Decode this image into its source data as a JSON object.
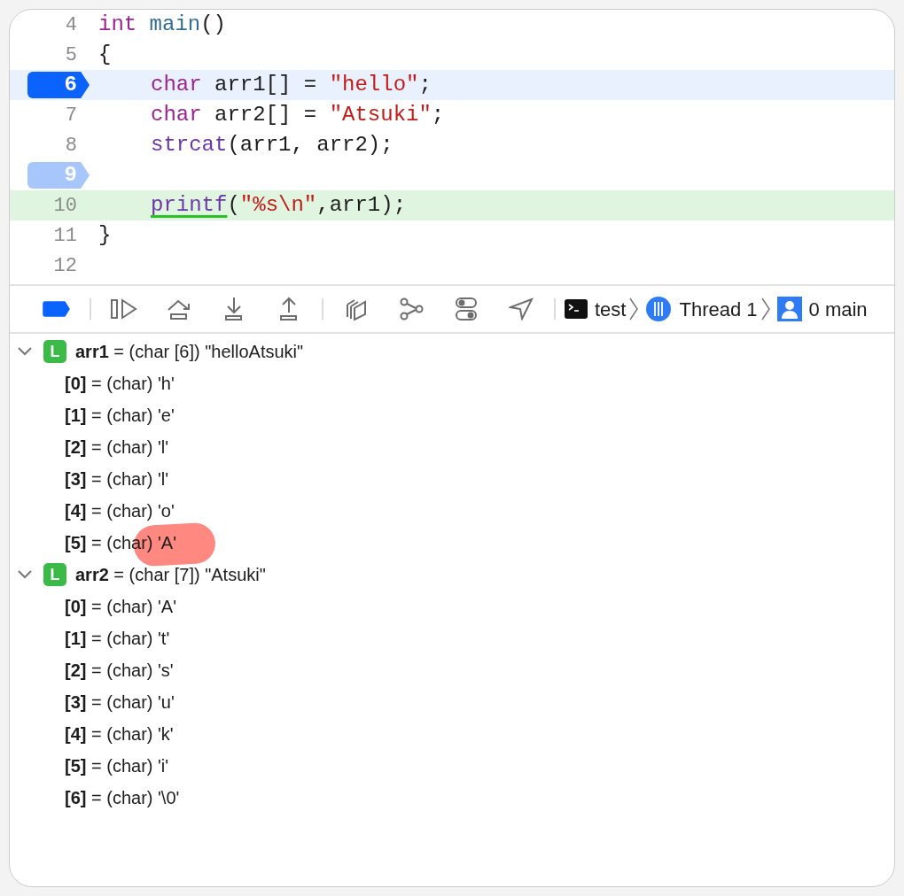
{
  "code_lines": [
    {
      "number": "4",
      "indented": false,
      "breakpoint": false,
      "current": false,
      "executed": false,
      "tokens": [
        {
          "kind": "keyword",
          "text": "int "
        },
        {
          "kind": "decl",
          "text": "main"
        },
        {
          "kind": "plain",
          "text": "()"
        }
      ]
    },
    {
      "number": "5",
      "indented": false,
      "breakpoint": false,
      "current": false,
      "executed": false,
      "tokens": [
        {
          "kind": "plain",
          "text": "{"
        }
      ]
    },
    {
      "number": "6",
      "indented": true,
      "breakpoint": true,
      "breakpoint_active": true,
      "current": true,
      "executed": false,
      "tokens": [
        {
          "kind": "keyword",
          "text": "char"
        },
        {
          "kind": "plain",
          "text": " arr1[] = "
        },
        {
          "kind": "string",
          "text": "\"hello\""
        },
        {
          "kind": "plain",
          "text": ";"
        }
      ]
    },
    {
      "number": "7",
      "indented": true,
      "breakpoint": false,
      "current": false,
      "executed": false,
      "tokens": [
        {
          "kind": "keyword",
          "text": "char"
        },
        {
          "kind": "plain",
          "text": " arr2[] = "
        },
        {
          "kind": "string",
          "text": "\"Atsuki\""
        },
        {
          "kind": "plain",
          "text": ";"
        }
      ]
    },
    {
      "number": "8",
      "indented": true,
      "breakpoint": false,
      "current": false,
      "executed": false,
      "tokens": [
        {
          "kind": "call",
          "text": "strcat"
        },
        {
          "kind": "plain",
          "text": "(arr1, arr2);"
        }
      ]
    },
    {
      "number": "9",
      "breakpoint": true,
      "breakpoint_active": false,
      "current": false,
      "executed": false
    },
    {
      "number": "10",
      "indented": true,
      "breakpoint": false,
      "current": false,
      "executed": true,
      "tokens": [
        {
          "kind": "call",
          "text": "printf",
          "underlined": true
        },
        {
          "kind": "plain",
          "text": "("
        },
        {
          "kind": "string",
          "text": "\"%s\\n\""
        },
        {
          "kind": "plain",
          "text": ",arr1);"
        }
      ]
    },
    {
      "number": "11",
      "indented": false,
      "breakpoint": false,
      "current": false,
      "executed": false,
      "tokens": [
        {
          "kind": "plain",
          "text": "}"
        }
      ]
    },
    {
      "number": "12",
      "breakpoint": false,
      "current": false,
      "executed": false
    }
  ],
  "debug_bar": {
    "tools": [
      {
        "kind": "breakpoints",
        "on": true
      },
      {
        "kind": "separator"
      },
      {
        "kind": "continue"
      },
      {
        "kind": "step-over"
      },
      {
        "kind": "step-into"
      },
      {
        "kind": "step-out"
      },
      {
        "kind": "separator"
      },
      {
        "kind": "view-hierarchy"
      },
      {
        "kind": "memory-graph"
      },
      {
        "kind": "environment"
      },
      {
        "kind": "location"
      },
      {
        "kind": "separator"
      }
    ],
    "breadcrumbs": [
      {
        "kind": "process",
        "label": "test"
      },
      {
        "kind": "thread",
        "label": "Thread 1"
      },
      {
        "kind": "frame",
        "label": "0 main"
      }
    ]
  },
  "variables": [
    {
      "badge": "L",
      "text": "**arr1** = (char [6]) \"helloAtsuki\"",
      "expanded": true,
      "children": [
        {
          "text": "**[0]** = (char) 'h'",
          "highlighted": false
        },
        {
          "text": "**[1]** = (char) 'e'",
          "highlighted": false
        },
        {
          "text": "**[2]** = (char) 'l'",
          "highlighted": false
        },
        {
          "text": "**[3]** = (char) 'l'",
          "highlighted": false
        },
        {
          "text": "**[4]** = (char) 'o'",
          "highlighted": false
        },
        {
          "text": "**[5]** = (char) 'A'",
          "highlighted": true
        }
      ]
    },
    {
      "badge": "L",
      "text": "**arr2** = (char [7]) \"Atsuki\"",
      "expanded": true,
      "children": [
        {
          "text": "**[0]** = (char) 'A'",
          "highlighted": false
        },
        {
          "text": "**[1]** = (char) 't'",
          "highlighted": false
        },
        {
          "text": "**[2]** = (char) 's'",
          "highlighted": false
        },
        {
          "text": "**[3]** = (char) 'u'",
          "highlighted": false
        },
        {
          "text": "**[4]** = (char) 'k'",
          "highlighted": false
        },
        {
          "text": "**[5]** = (char) 'i'",
          "highlighted": false
        },
        {
          "text": "**[6]** = (char) '\\0'",
          "highlighted": false
        }
      ]
    }
  ]
}
